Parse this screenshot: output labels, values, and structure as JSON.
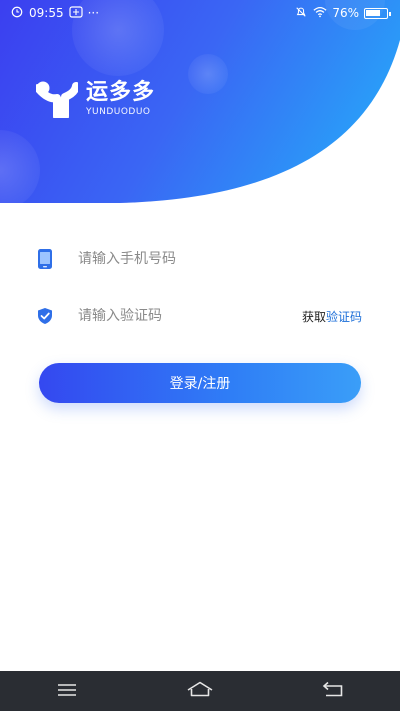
{
  "status_bar": {
    "time": "09:55",
    "more": "···",
    "battery_text": "76%",
    "battery_level": 0.76
  },
  "brand": {
    "name": "运多多",
    "name_latin": "YUNDUODUO"
  },
  "form": {
    "phone_placeholder": "请输入手机号码",
    "code_placeholder": "请输入验证码",
    "get_code_prefix": "获取",
    "get_code_accent": "验证码",
    "submit_label": "登录/注册"
  },
  "colors": {
    "gradient_start": "#3b3ff0",
    "gradient_end": "#2a8ff8",
    "accent": "#1b6ed8",
    "navbar": "#2a2d33"
  },
  "icons": {
    "phone": "phone-icon",
    "code": "shield-check-icon",
    "menu": "menu-icon",
    "home": "home-icon",
    "back": "back-icon"
  }
}
